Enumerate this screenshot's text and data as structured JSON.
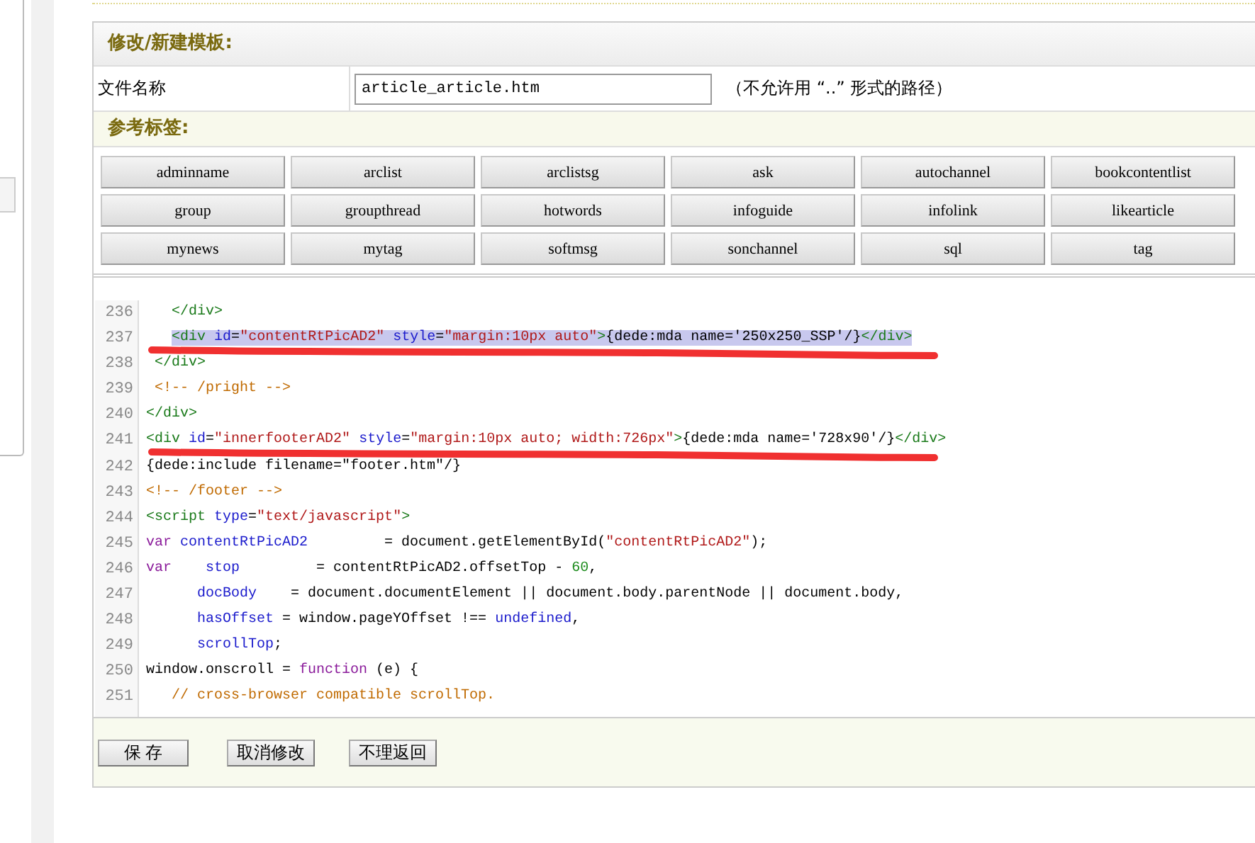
{
  "form_title": "修改/新建模板:",
  "file_field": {
    "label": "文件名称",
    "value": "article_article.htm",
    "hint": "（不允许用 “..” 形式的路径）"
  },
  "tags_title": "参考标签:",
  "tag_buttons": [
    "adminname",
    "arclist",
    "arclistsg",
    "ask",
    "autochannel",
    "bookcontentlist",
    "group",
    "groupthread",
    "hotwords",
    "infoguide",
    "infolink",
    "likearticle",
    "mynews",
    "mytag",
    "softmsg",
    "sonchannel",
    "sql",
    "tag"
  ],
  "code_lines": [
    {
      "number": "236",
      "selected": false,
      "underlined": false,
      "tokens": [
        {
          "kind": "tag",
          "text": "   </div>"
        }
      ]
    },
    {
      "number": "237",
      "selected": true,
      "underlined": true,
      "tokens": [
        {
          "kind": "tag",
          "text": "   <div "
        },
        {
          "kind": "attr",
          "text": "id"
        },
        {
          "kind": "plain",
          "text": "="
        },
        {
          "kind": "string",
          "text": "\"contentRtPicAD2\""
        },
        {
          "kind": "attr",
          "text": " style"
        },
        {
          "kind": "plain",
          "text": "="
        },
        {
          "kind": "string",
          "text": "\"margin:10px auto\""
        },
        {
          "kind": "tag",
          "text": ">"
        },
        {
          "kind": "plain",
          "text": "{dede:mda name='250x250_SSP'/}"
        },
        {
          "kind": "tag",
          "text": "</div>"
        }
      ]
    },
    {
      "number": "238",
      "selected": false,
      "underlined": false,
      "tokens": [
        {
          "kind": "tag",
          "text": " </div>"
        }
      ]
    },
    {
      "number": "239",
      "selected": false,
      "underlined": false,
      "tokens": [
        {
          "kind": "comment",
          "text": " <!-- /pright -->"
        }
      ]
    },
    {
      "number": "240",
      "selected": false,
      "underlined": false,
      "tokens": [
        {
          "kind": "tag",
          "text": "</div>"
        }
      ]
    },
    {
      "number": "241",
      "selected": false,
      "underlined": true,
      "tokens": [
        {
          "kind": "tag",
          "text": "<div "
        },
        {
          "kind": "attr",
          "text": "id"
        },
        {
          "kind": "plain",
          "text": "="
        },
        {
          "kind": "string",
          "text": "\"innerfooterAD2\""
        },
        {
          "kind": "attr",
          "text": " style"
        },
        {
          "kind": "plain",
          "text": "="
        },
        {
          "kind": "string",
          "text": "\"margin:10px auto; width:726px\""
        },
        {
          "kind": "tag",
          "text": ">"
        },
        {
          "kind": "plain",
          "text": "{dede:mda name='728x90'/}"
        },
        {
          "kind": "tag",
          "text": "</div>"
        }
      ]
    },
    {
      "number": "242",
      "selected": false,
      "underlined": false,
      "tokens": [
        {
          "kind": "plain",
          "text": "{dede:include filename=\"footer.htm\"/}"
        }
      ]
    },
    {
      "number": "243",
      "selected": false,
      "underlined": false,
      "tokens": [
        {
          "kind": "comment",
          "text": "<!-- /footer -->"
        }
      ]
    },
    {
      "number": "244",
      "selected": false,
      "underlined": false,
      "tokens": [
        {
          "kind": "tag",
          "text": "<script "
        },
        {
          "kind": "attr",
          "text": "type"
        },
        {
          "kind": "plain",
          "text": "="
        },
        {
          "kind": "string",
          "text": "\"text/javascript\""
        },
        {
          "kind": "tag",
          "text": ">"
        }
      ]
    },
    {
      "number": "245",
      "selected": false,
      "underlined": false,
      "tokens": [
        {
          "kind": "keyword",
          "text": "var"
        },
        {
          "kind": "ident",
          "text": " contentRtPicAD2"
        },
        {
          "kind": "plain",
          "text": "         = document.getElementById("
        },
        {
          "kind": "string",
          "text": "\"contentRtPicAD2\""
        },
        {
          "kind": "plain",
          "text": ");"
        }
      ]
    },
    {
      "number": "246",
      "selected": false,
      "underlined": false,
      "tokens": [
        {
          "kind": "keyword",
          "text": "var"
        },
        {
          "kind": "ident",
          "text": "    stop"
        },
        {
          "kind": "plain",
          "text": "         = contentRtPicAD2.offsetTop - "
        },
        {
          "kind": "number",
          "text": "60"
        },
        {
          "kind": "plain",
          "text": ","
        }
      ]
    },
    {
      "number": "247",
      "selected": false,
      "underlined": false,
      "tokens": [
        {
          "kind": "ident",
          "text": "      docBody"
        },
        {
          "kind": "plain",
          "text": "    = document.documentElement || document.body.parentNode || document.body,"
        }
      ]
    },
    {
      "number": "248",
      "selected": false,
      "underlined": false,
      "tokens": [
        {
          "kind": "ident",
          "text": "      hasOffset"
        },
        {
          "kind": "plain",
          "text": " = window.pageYOffset !== "
        },
        {
          "kind": "ident",
          "text": "undefined"
        },
        {
          "kind": "plain",
          "text": ","
        }
      ]
    },
    {
      "number": "249",
      "selected": false,
      "underlined": false,
      "tokens": [
        {
          "kind": "ident",
          "text": "      scrollTop"
        },
        {
          "kind": "plain",
          "text": ";"
        }
      ]
    },
    {
      "number": "250",
      "selected": false,
      "underlined": false,
      "tokens": [
        {
          "kind": "plain",
          "text": "window.onscroll = "
        },
        {
          "kind": "keyword",
          "text": "function"
        },
        {
          "kind": "plain",
          "text": " (e) {"
        }
      ]
    },
    {
      "number": "251",
      "selected": false,
      "underlined": false,
      "tokens": [
        {
          "kind": "comment",
          "text": "   // cross-browser compatible scrollTop."
        }
      ]
    }
  ],
  "actions": [
    "保 存",
    "取消修改",
    "不理返回"
  ]
}
